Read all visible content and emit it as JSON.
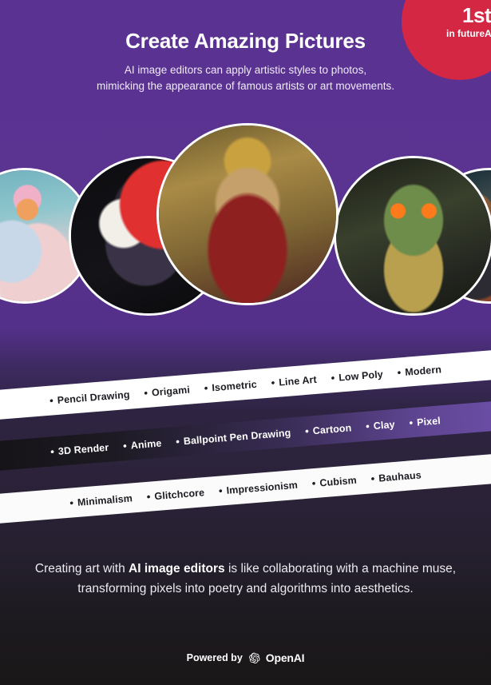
{
  "badge": {
    "rank": "1st",
    "rank_superscript": "°",
    "caption": "in futureAI",
    "color": "#d32744"
  },
  "header": {
    "title": "Create Amazing Pictures",
    "subtitle_line1": "AI image editors can apply artistic styles to photos,",
    "subtitle_line2": "mimicking the appearance of famous artists or art movements."
  },
  "gallery": {
    "items": [
      {
        "name": "skater-girl-illustration",
        "alt": "Stylized girl on a skateboard in pink beanie"
      },
      {
        "name": "anime-swordsman-illustration",
        "alt": "Anime character with sword on red moon background"
      },
      {
        "name": "lion-king-portrait",
        "alt": "Regal lion wearing a golden crown and red robe"
      },
      {
        "name": "frog-knight-illustration",
        "alt": "Armored frog creature with glowing orange eyes"
      },
      {
        "name": "two-children-illustration",
        "alt": "Two children in jackets, warm firelight"
      }
    ]
  },
  "tag_rows": [
    {
      "theme": "light",
      "tags": [
        "Pencil Drawing",
        "Origami",
        "Isometric",
        "Line Art",
        "Low Poly",
        "Modern"
      ]
    },
    {
      "theme": "dark",
      "tags": [
        "3D Render",
        "Anime",
        "Ballpoint Pen Drawing",
        "Cartoon",
        "Clay",
        "Pixel"
      ]
    },
    {
      "theme": "light",
      "tags": [
        "Minimalism",
        "Glitchcore",
        "Impressionism",
        "Cubism",
        "Bauhaus"
      ]
    }
  ],
  "quote": {
    "part1": "Creating art with ",
    "highlight": "AI image editors",
    "part2": " is like collaborating with a machine muse, transforming pixels into poetry and algorithms into aesthetics."
  },
  "footer": {
    "powered_by": "Powered by",
    "brand": "OpenAI",
    "logo_icon": "openai-logo-icon"
  },
  "colors": {
    "background_top": "#5a3291",
    "background_bottom": "#1a1718",
    "accent_red": "#d32744",
    "row_light": "#ffffff",
    "row_dark_start": "#141215",
    "row_dark_end": "#6f50ad"
  }
}
